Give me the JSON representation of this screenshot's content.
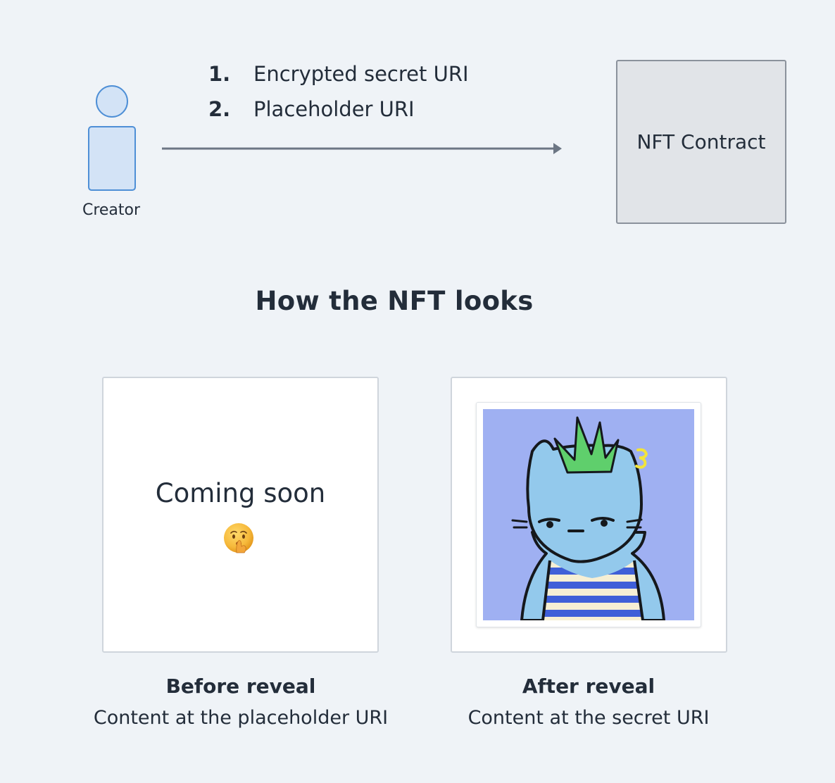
{
  "creator": {
    "label": "Creator"
  },
  "steps": [
    {
      "number": "1.",
      "text": "Encrypted secret URI"
    },
    {
      "number": "2.",
      "text": "Placeholder URI"
    }
  ],
  "contract": {
    "label": "NFT Contract"
  },
  "section": {
    "title": "How the NFT looks"
  },
  "before": {
    "card_text": "Coming soon",
    "emoji": "shushing-face-icon",
    "title": "Before reveal",
    "subtitle": "Content at the placeholder URI"
  },
  "after": {
    "image": "nft-cat-character-image",
    "title": "After reveal",
    "subtitle": "Content at the secret URI"
  },
  "colors": {
    "background": "#eff3f7",
    "creator_stroke": "#4e8fd6",
    "creator_fill": "#d3e3f6",
    "arrow": "#6c7684",
    "contract_fill": "#e1e4e8",
    "nft_background": "#9fb0f2",
    "nft_character": "#93c9ec",
    "nft_mohawk": "#5fcf6c"
  }
}
